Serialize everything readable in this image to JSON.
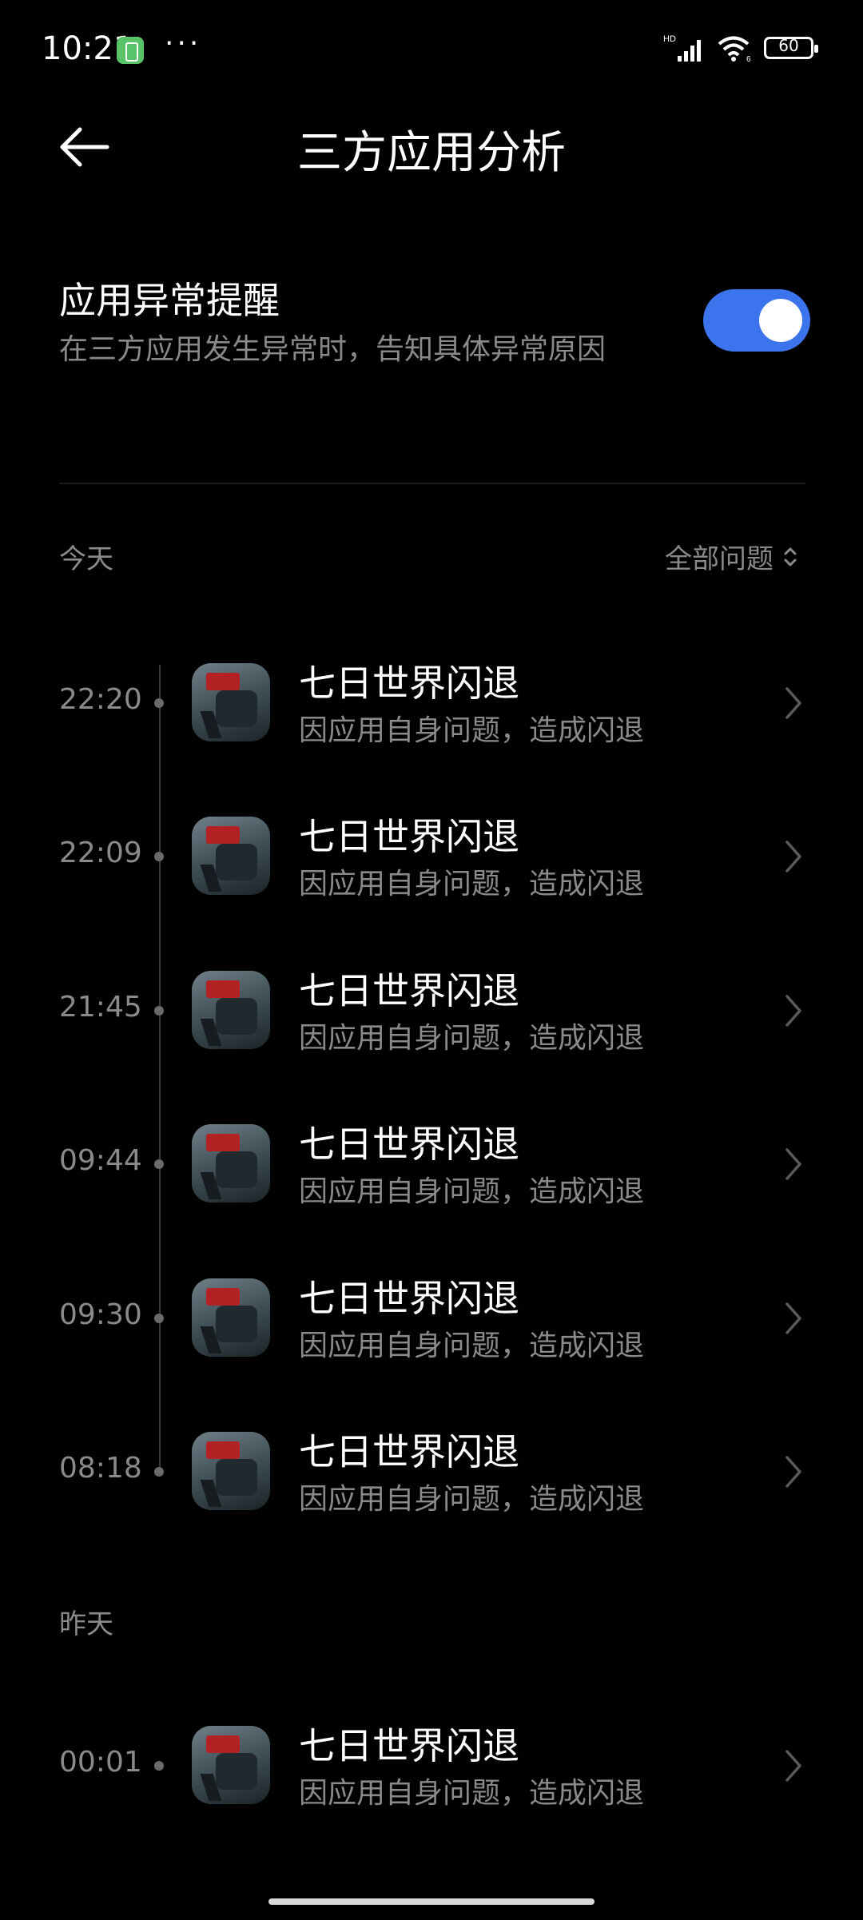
{
  "status_bar": {
    "time": "10:21",
    "dots": "···",
    "network": "HD",
    "wifi": "6",
    "battery": "60"
  },
  "header": {
    "title": "三方应用分析"
  },
  "setting": {
    "title": "应用异常提醒",
    "description": "在三方应用发生异常时，告知具体异常原因",
    "enabled": true
  },
  "colors": {
    "accent": "#3b74ed",
    "secondary_text": "#8a8a8a",
    "background": "#000000"
  },
  "today_label": "今天",
  "filter_label": "全部问题",
  "yesterday_label": "昨天",
  "today_entries": [
    {
      "time": "22:20",
      "title": "七日世界闪退",
      "desc": "因应用自身问题，造成闪退"
    },
    {
      "time": "22:09",
      "title": "七日世界闪退",
      "desc": "因应用自身问题，造成闪退"
    },
    {
      "time": "21:45",
      "title": "七日世界闪退",
      "desc": "因应用自身问题，造成闪退"
    },
    {
      "time": "09:44",
      "title": "七日世界闪退",
      "desc": "因应用自身问题，造成闪退"
    },
    {
      "time": "09:30",
      "title": "七日世界闪退",
      "desc": "因应用自身问题，造成闪退"
    },
    {
      "time": "08:18",
      "title": "七日世界闪退",
      "desc": "因应用自身问题，造成闪退"
    }
  ],
  "yesterday_entries": [
    {
      "time": "00:01",
      "title": "七日世界闪退",
      "desc": "因应用自身问题，造成闪退"
    }
  ]
}
